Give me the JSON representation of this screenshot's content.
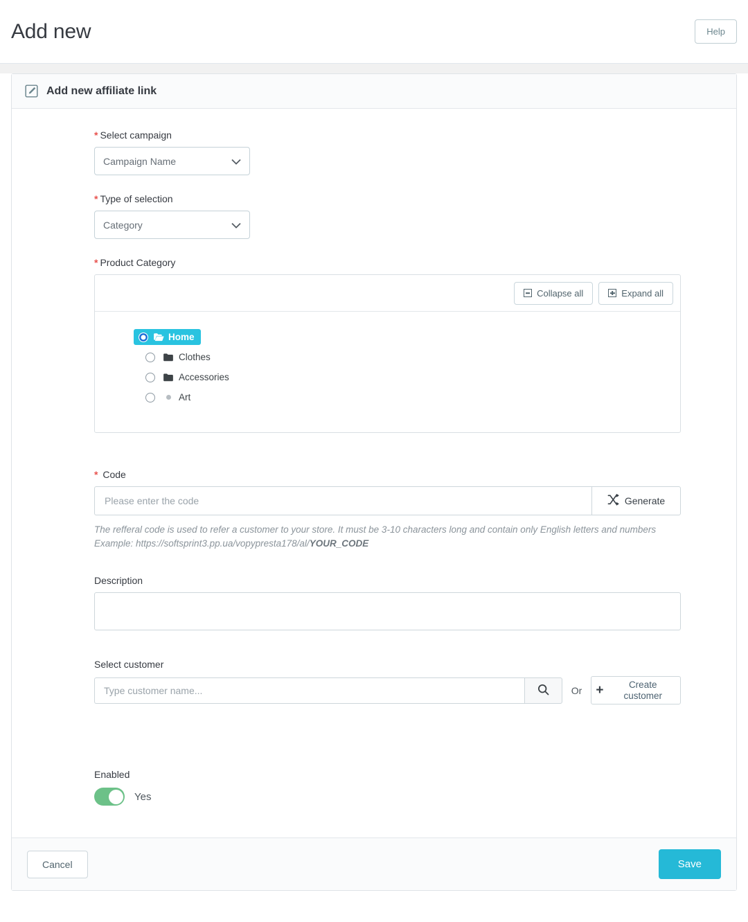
{
  "header": {
    "title": "Add new",
    "help_label": "Help"
  },
  "panel": {
    "icon": "pencil-square-icon",
    "title": "Add new affiliate link"
  },
  "form": {
    "campaign": {
      "label": "Select campaign",
      "required_marker": "*",
      "selected": "Campaign Name"
    },
    "selection_type": {
      "label": "Type of selection",
      "required_marker": "*",
      "selected": "Category"
    },
    "product_category": {
      "label": "Product Category",
      "required_marker": "*",
      "collapse_all_label": "Collapse all",
      "expand_all_label": "Expand all",
      "tree": [
        {
          "label": "Home",
          "icon": "open-folder-icon",
          "selected": true,
          "depth": 0
        },
        {
          "label": "Clothes",
          "icon": "folder-icon",
          "selected": false,
          "depth": 1
        },
        {
          "label": "Accessories",
          "icon": "folder-icon",
          "selected": false,
          "depth": 1
        },
        {
          "label": "Art",
          "icon": "leaf-dot-icon",
          "selected": false,
          "depth": 1
        }
      ]
    },
    "code": {
      "label": "Code",
      "required_marker": "*",
      "placeholder": "Please enter the code",
      "value": "",
      "generate_label": "Generate",
      "helper_line1": "The refferal code is used to refer a customer to your store. It must be 3-10 characters long and contain only English letters and numbers",
      "helper_line2_prefix": "Example: https://softsprint3.pp.ua/vopypresta178/al/",
      "helper_line2_code": "YOUR_CODE"
    },
    "description": {
      "label": "Description",
      "value": ""
    },
    "customer": {
      "label": "Select customer",
      "placeholder": "Type customer name...",
      "value": "",
      "or_label": "Or",
      "create_label": "Create customer",
      "search_icon": "search-icon",
      "plus_icon": "plus-icon"
    },
    "enabled": {
      "label": "Enabled",
      "state_label": "Yes",
      "on": true
    }
  },
  "footer": {
    "cancel_label": "Cancel",
    "save_label": "Save"
  },
  "colors": {
    "accent": "#25b9d7",
    "tree_selected": "#29c3e0",
    "toggle_on": "#6cc188",
    "required": "#e8534f",
    "page_bg": "#f1f1f1"
  }
}
